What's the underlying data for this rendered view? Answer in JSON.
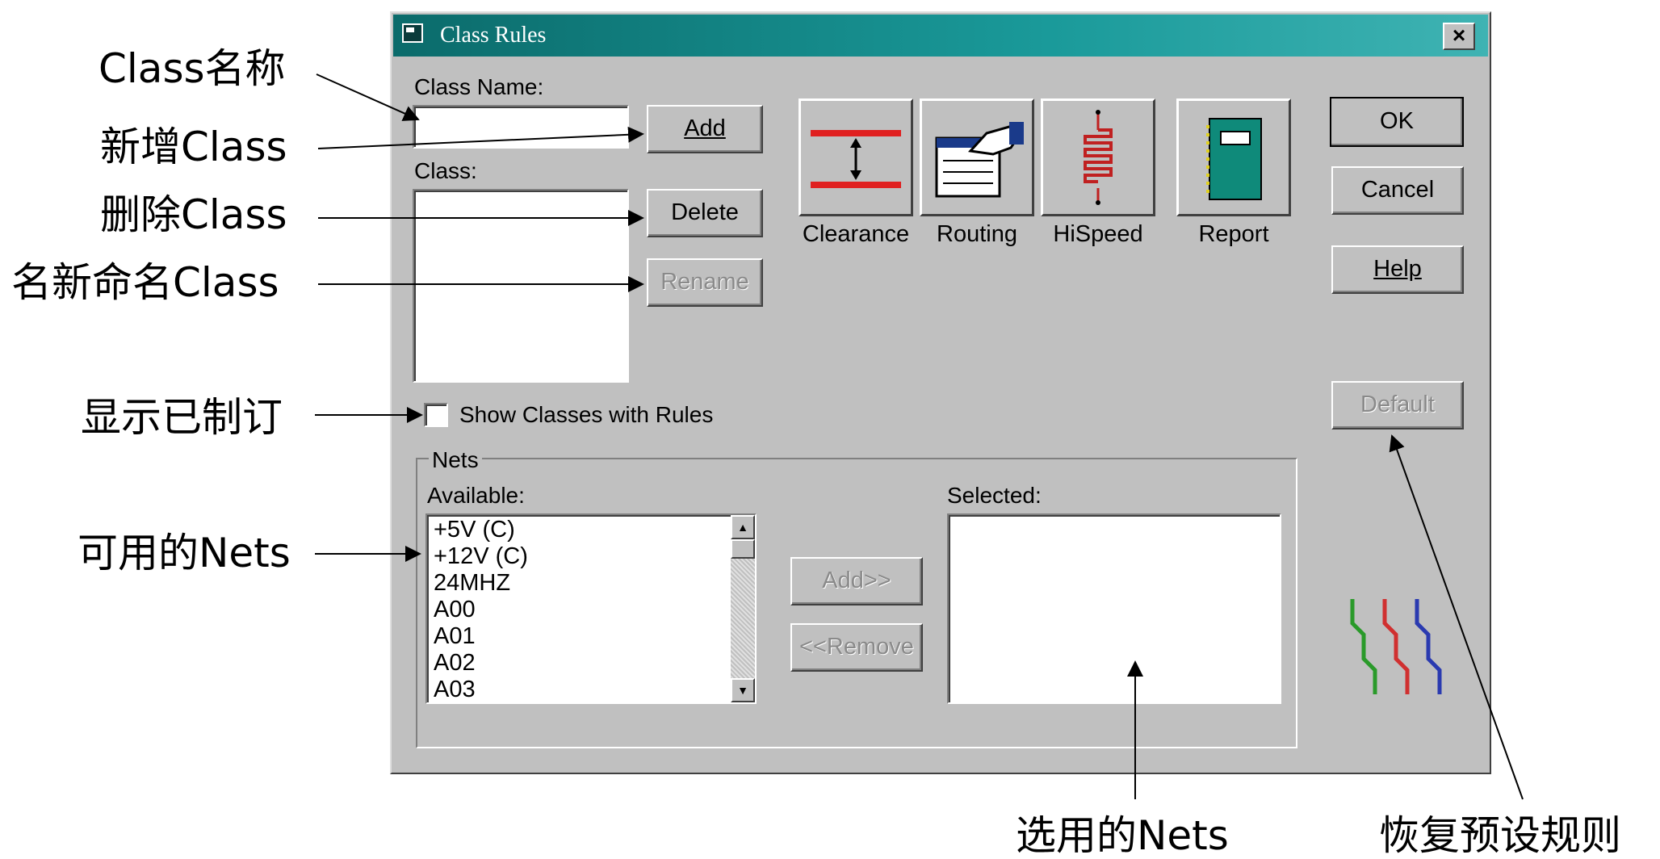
{
  "dialog": {
    "title": "Class Rules",
    "close_label": "×",
    "class_name_label": "Class Name:",
    "class_name_value": "",
    "class_label": "Class:",
    "buttons": {
      "add": "Add",
      "delete": "Delete",
      "rename": "Rename",
      "ok": "OK",
      "cancel": "Cancel",
      "help": "Help",
      "default": "Default"
    },
    "rule_buttons": [
      {
        "label": "Clearance",
        "icon": "clearance-icon"
      },
      {
        "label": "Routing",
        "icon": "routing-icon"
      },
      {
        "label": "HiSpeed",
        "icon": "hispeed-icon"
      },
      {
        "label": "Report",
        "icon": "report-icon"
      }
    ],
    "show_classes_checkbox": {
      "label": "Show Classes with Rules",
      "checked": false
    },
    "nets": {
      "group_label": "Nets",
      "available_label": "Available:",
      "selected_label": "Selected:",
      "available_items": [
        "+5V (C)",
        "+12V (C)",
        "24MHZ",
        "A00",
        "A01",
        "A02",
        "A03"
      ],
      "selected_items": [],
      "add_button": "Add>>",
      "remove_button": "<<Remove"
    }
  },
  "annotations": {
    "class_name": "Class名称",
    "add_class": "新增Class",
    "delete_class": "删除Class",
    "rename_class": "名新命名Class",
    "show_defined": "显示已制订",
    "available_nets": "可用的Nets",
    "selected_nets": "选用的Nets",
    "restore_defaults": "恢复预设规则"
  },
  "colors": {
    "titlebar": "#0b6b6b",
    "dialog_bg": "#c0c0c0"
  }
}
